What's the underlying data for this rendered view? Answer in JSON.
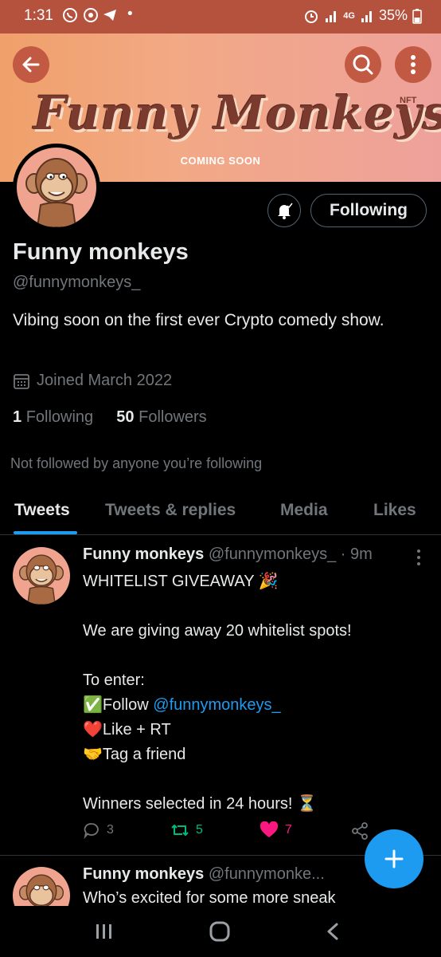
{
  "status_bar": {
    "time": "1:31",
    "signal_label": "4G",
    "battery": "35%"
  },
  "banner": {
    "logo": "Funny Monkeys",
    "nft_tag": "NFT",
    "coming_soon": "COMING SOON"
  },
  "profile": {
    "follow_button": "Following",
    "name": "Funny monkeys",
    "handle": "@funnymonkeys_",
    "bio": "Vibing soon on the first ever Crypto comedy show.",
    "joined": "Joined March 2022",
    "following_count": "1",
    "following_label": "Following",
    "followers_count": "50",
    "followers_label": "Followers",
    "not_followed": "Not followed by anyone you’re following"
  },
  "tabs": [
    "Tweets",
    "Tweets & replies",
    "Media",
    "Likes"
  ],
  "tweets": [
    {
      "name": "Funny monkeys",
      "handle": "@funnymonkeys_",
      "time": "· 9m",
      "line1": "WHITELIST GIVEAWAY 🎉",
      "line2": "We are giving away 20 whitelist spots!",
      "line3": "To enter:",
      "line4a": "✅Follow ",
      "line4_mention": "@funnymonkeys_",
      "line5": "❤️Like + RT",
      "line6": "🤝Tag a friend",
      "line7": "Winners selected in 24 hours! ⏳",
      "replies": "3",
      "retweets": "5",
      "likes": "7"
    },
    {
      "name": "Funny monkeys",
      "handle": "@funnymonke...",
      "text": "Who’s excited for some more sneak"
    }
  ],
  "colors": {
    "accent": "#1d9bf0",
    "retweet": "#00ba7c",
    "like": "#f91880",
    "status_bar": "#b5523e"
  }
}
